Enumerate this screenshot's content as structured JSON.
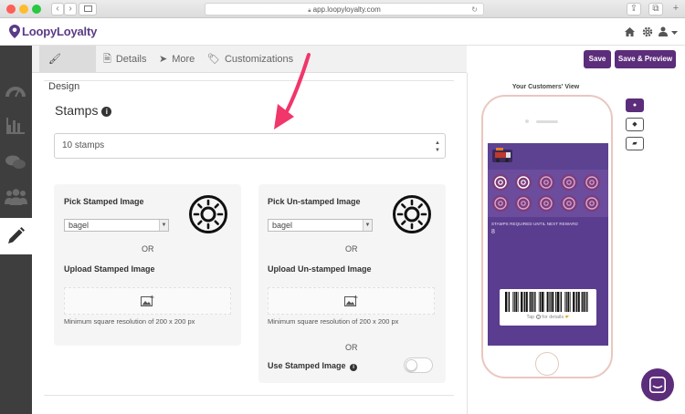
{
  "browser": {
    "url": "app.loopyloyalty.com"
  },
  "header": {
    "logo": "LoopyLoyalty"
  },
  "tabs": [
    {
      "label": "Design",
      "icon": "brush-icon"
    },
    {
      "label": "Details",
      "icon": "document-icon"
    },
    {
      "label": "More",
      "icon": "send-icon"
    },
    {
      "label": "Customizations",
      "icon": "tags-icon"
    }
  ],
  "toolbar": {
    "save_label": "Save",
    "save_preview_label": "Save & Preview"
  },
  "stamps": {
    "title": "Stamps",
    "select_value": "10 stamps"
  },
  "stamped_panel": {
    "pick_label": "Pick Stamped Image",
    "image_value": "bagel",
    "or_label": "OR",
    "upload_label": "Upload Stamped Image",
    "min_res": "Minimum square resolution of 200 x 200 px"
  },
  "unstamped_panel": {
    "pick_label": "Pick Un-stamped Image",
    "image_value": "bagel",
    "or_label": "OR",
    "upload_label": "Upload Un-stamped Image",
    "min_res": "Minimum square resolution of 200 x 200 px",
    "or_label_2": "OR",
    "use_stamped_label": "Use Stamped Image"
  },
  "preview": {
    "title": "Your Customers' View",
    "reward_label": "STAMPS REQUIRED UNTIL NEXT REWARD",
    "reward_count": "8",
    "tap_text_before": "Tap",
    "tap_text_after": "for details"
  },
  "colors": {
    "brand": "#5c2d7b",
    "card_bg": "#5a3d8e",
    "stamp_fill": "#7d3c7a",
    "arrow": "#f0366a"
  }
}
